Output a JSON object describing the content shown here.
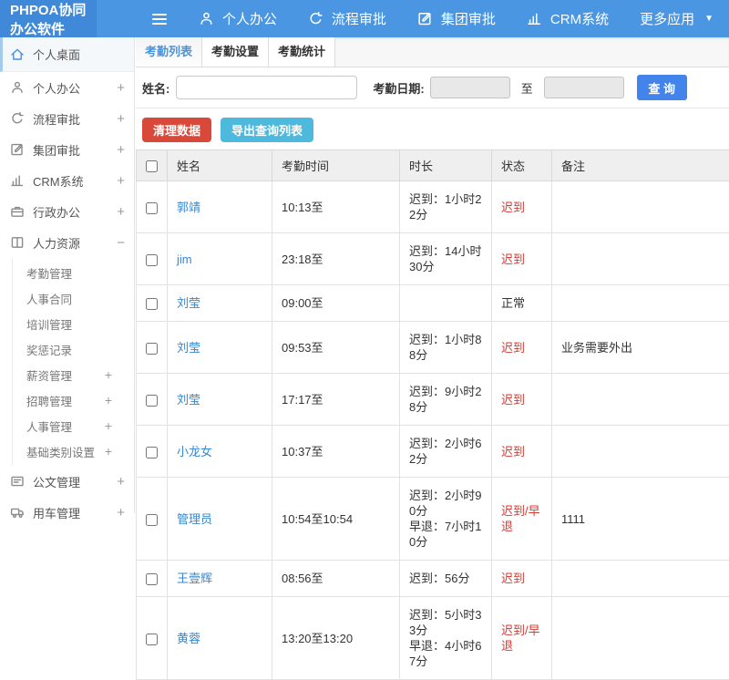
{
  "colors": {
    "navbar_bg": "#4a96e2",
    "brand_bg": "#4089d8",
    "accent_blue": "#4384ec",
    "tab_active_text": "#4c94d9",
    "link_blue": "#3787d2",
    "danger_red": "#d8493a",
    "export_cyan": "#4db9dd",
    "status_late": "#d43c35",
    "status_normal": "#333333"
  },
  "navbar": {
    "brand": "PHPOA协同办公软件",
    "items": [
      {
        "key": "personal-office",
        "icon": "user-icon",
        "label": "个人办公"
      },
      {
        "key": "workflow-approval",
        "icon": "process-icon",
        "label": "流程审批"
      },
      {
        "key": "group-approval",
        "icon": "edit-icon",
        "label": "集团审批"
      },
      {
        "key": "crm-system",
        "icon": "chart-icon",
        "label": "CRM系统"
      }
    ],
    "more_label": "更多应用"
  },
  "sidebar": {
    "items": [
      {
        "key": "personal-desktop",
        "icon": "home-icon",
        "label": "个人桌面",
        "active": true,
        "expand": ""
      },
      {
        "key": "personal-office",
        "icon": "user-icon",
        "label": "个人办公",
        "expand": "+"
      },
      {
        "key": "workflow-approval",
        "icon": "process-icon",
        "label": "流程审批",
        "expand": "+"
      },
      {
        "key": "group-approval",
        "icon": "edit-icon",
        "label": "集团审批",
        "expand": "+"
      },
      {
        "key": "crm-system",
        "icon": "chart-icon",
        "label": "CRM系统",
        "expand": "+"
      },
      {
        "key": "admin-office",
        "icon": "briefcase-icon",
        "label": "行政办公",
        "expand": "+"
      },
      {
        "key": "human-resources",
        "icon": "book-icon",
        "label": "人力资源",
        "expand": "-",
        "children": [
          {
            "key": "attendance-management",
            "label": "考勤管理",
            "expand": ""
          },
          {
            "key": "hr-contract",
            "label": "人事合同",
            "expand": ""
          },
          {
            "key": "training-management",
            "label": "培训管理",
            "expand": ""
          },
          {
            "key": "reward-punishment",
            "label": "奖惩记录",
            "expand": ""
          },
          {
            "key": "salary-management",
            "label": "薪资管理",
            "expand": "+"
          },
          {
            "key": "recruitment-management",
            "label": "招聘管理",
            "expand": "+"
          },
          {
            "key": "personnel-management",
            "label": "人事管理",
            "expand": "+"
          },
          {
            "key": "base-category-settings",
            "label": "基础类别设置",
            "expand": "+"
          }
        ]
      },
      {
        "key": "document-management",
        "icon": "document-icon",
        "label": "公文管理",
        "expand": "+"
      },
      {
        "key": "vehicle-management",
        "icon": "truck-icon",
        "label": "用车管理",
        "expand": "+"
      }
    ]
  },
  "tabs": [
    {
      "key": "attendance-list",
      "label": "考勤列表",
      "active": true
    },
    {
      "key": "attendance-settings",
      "label": "考勤设置",
      "active": false
    },
    {
      "key": "attendance-stats",
      "label": "考勤统计",
      "active": false
    }
  ],
  "filter": {
    "name_label": "姓名:",
    "name_value": "",
    "date_label": "考勤日期:",
    "date_from": "",
    "to_label": "至",
    "date_to": "",
    "search_label": "查 询"
  },
  "actions": {
    "clean_label": "清理数据",
    "export_label": "导出查询列表"
  },
  "table": {
    "columns": [
      "姓名",
      "考勤时间",
      "时长",
      "状态",
      "备注"
    ],
    "rows": [
      {
        "name": "郭靖",
        "time": "10:13至",
        "duration": [
          "迟到：1小时22分"
        ],
        "status": "迟到",
        "late": true,
        "remark": ""
      },
      {
        "name": "jim",
        "time": "23:18至",
        "duration": [
          "迟到：14小时30分"
        ],
        "status": "迟到",
        "late": true,
        "remark": ""
      },
      {
        "name": "刘莹",
        "time": "09:00至",
        "duration": [],
        "status": "正常",
        "late": false,
        "remark": ""
      },
      {
        "name": "刘莹",
        "time": "09:53至",
        "duration": [
          "迟到：1小时88分"
        ],
        "status": "迟到",
        "late": true,
        "remark": "业务需要外出"
      },
      {
        "name": "刘莹",
        "time": "17:17至",
        "duration": [
          "迟到：9小时28分"
        ],
        "status": "迟到",
        "late": true,
        "remark": ""
      },
      {
        "name": "小龙女",
        "time": "10:37至",
        "duration": [
          "迟到：2小时62分"
        ],
        "status": "迟到",
        "late": true,
        "remark": ""
      },
      {
        "name": "管理员",
        "time": "10:54至10:54",
        "duration": [
          "迟到：2小时90分",
          "早退：7小时10分"
        ],
        "status": "迟到/早退",
        "late": true,
        "remark": "1111"
      },
      {
        "name": "王壹辉",
        "time": "08:56至",
        "duration": [
          "迟到：56分"
        ],
        "status": "迟到",
        "late": true,
        "remark": ""
      },
      {
        "name": "黄蓉",
        "time": "13:20至13:20",
        "duration": [
          "迟到：5小时33分",
          "早退：4小时67分"
        ],
        "status": "迟到/早退",
        "late": true,
        "remark": ""
      }
    ]
  }
}
